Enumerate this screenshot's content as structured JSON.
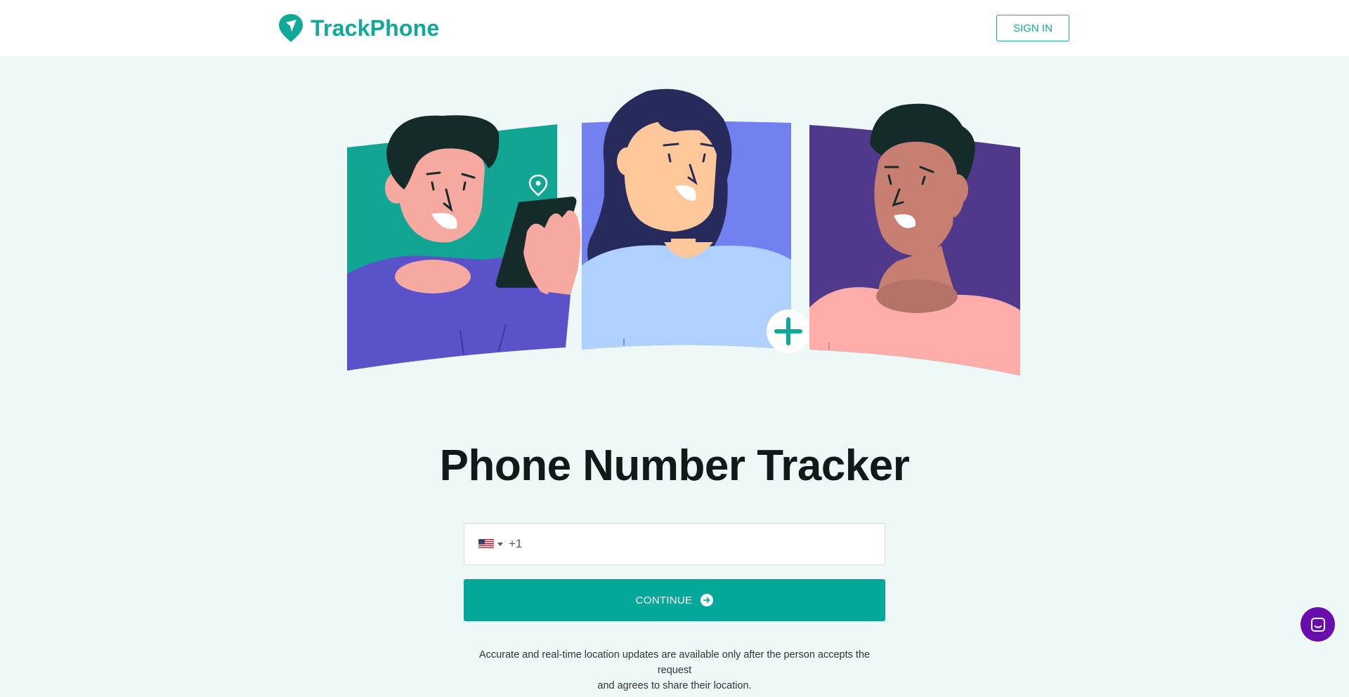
{
  "header": {
    "brand": "TrackPhone",
    "signin_label": "SIGN IN"
  },
  "main": {
    "title": "Phone Number Tracker",
    "phone": {
      "country_icon": "us-flag-icon",
      "dial_code_placeholder": "+1",
      "value": ""
    },
    "continue_label": "CONTINUE",
    "disclaimer_line1": "Accurate and real-time location updates are available only after the person accepts the request",
    "disclaimer_line2": "and agrees to share their location."
  },
  "colors": {
    "brand": "#10a898",
    "button": "#04a89a",
    "background": "#eef8f6",
    "chat": "#6a0dad"
  },
  "icons": [
    "location-pin-logo-icon",
    "us-flag-icon",
    "chevron-down-icon",
    "arrow-right-icon",
    "plus-icon",
    "chat-icon"
  ]
}
